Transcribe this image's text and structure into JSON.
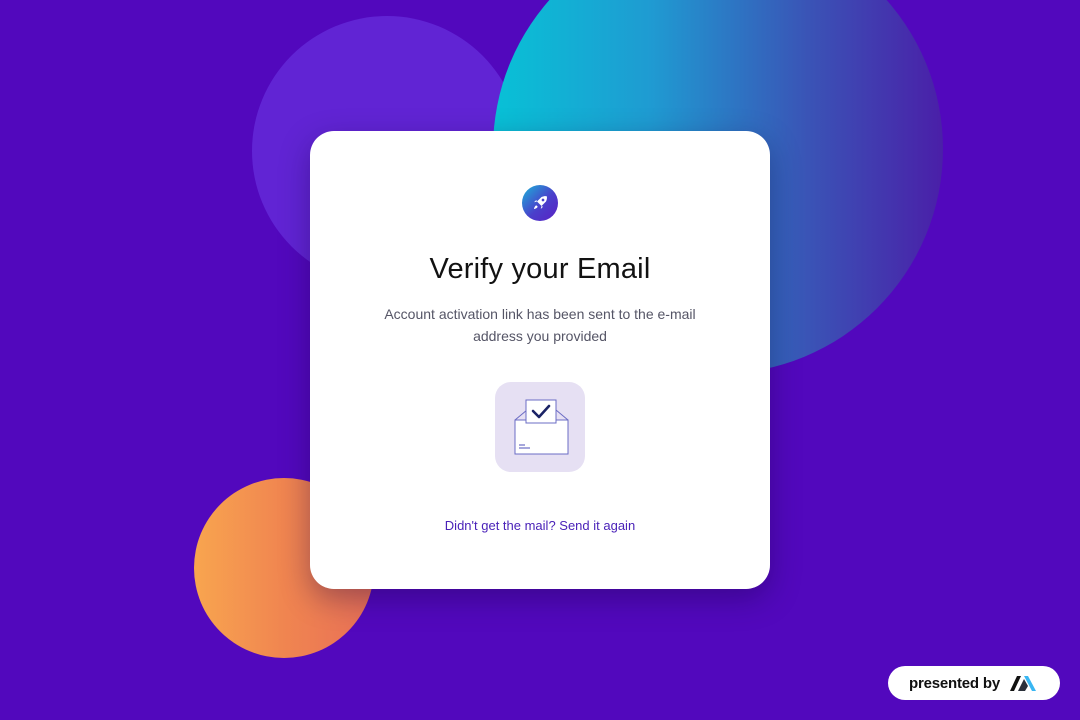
{
  "verify": {
    "logo_icon": "rocket-icon",
    "title": "Verify your Email",
    "subtitle": "Account activation link has been sent to the e-mail address you provided",
    "illustration_icon": "envelope-check-icon",
    "resend_link": "Didn't get the mail? Send it again"
  },
  "badge": {
    "text": "presented by",
    "logo_icon": "brand-m-logo"
  },
  "colors": {
    "background": "#5208bd",
    "card": "#ffffff",
    "link": "#4a22b8",
    "illustration_bg": "#e6e0f3"
  }
}
